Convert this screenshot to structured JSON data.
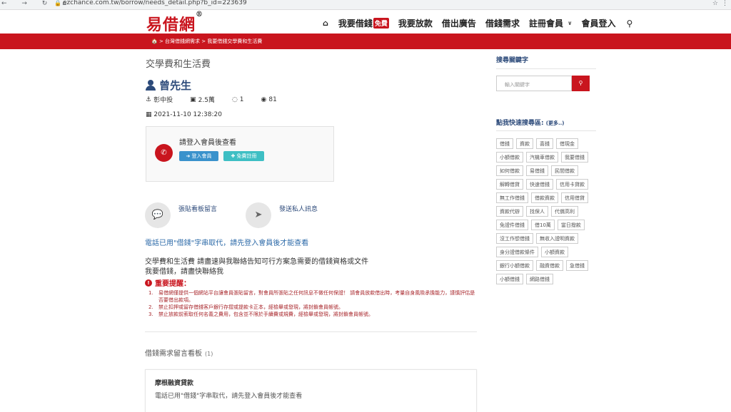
{
  "browser": {
    "nav_icons": "← → ↻ ⌂",
    "url": "ezchance.com.tw/borrow/needs_detail.php?b_id=223639",
    "star": "☆",
    "kebab": "⋮"
  },
  "header": {
    "logo": "易借網",
    "logo_mark": "®",
    "menu": {
      "home_icon": "home-icon",
      "borrow": "我要借錢",
      "borrow_badge": "免費",
      "lend": "我要放款",
      "ad": "借出廣告",
      "needs": "借錢需求",
      "register": "註冊會員",
      "login": "會員登入"
    }
  },
  "breadcrumb": "🏠 > 台灣借錢網需求 > 我要借錢交學費和生活費",
  "post": {
    "title": "交學費和生活費",
    "user": "曾先生",
    "location": "彰中投",
    "amount": "2.5萬",
    "replies": "1",
    "views": "81",
    "datetime": "2021-11-10 12:38:20",
    "login_prompt": "請登入會員後查看",
    "login_button": "登入會員",
    "register_button": "免費註冊",
    "action_board": "張貼看板留言",
    "action_private": "發送私人訊息",
    "phone_note": "電話已用\"借錢\"字串取代，請先登入會員後才能查看",
    "desc_line1": "交學費和生活費 請盡速與我聯絡告知可行方案急需要的借錢資格或文件",
    "desc_line2": "我要借錢，請盡快聯絡我",
    "warning_title": "重要提醒：",
    "warnings": [
      "易借網僅提供一個網站平台讓會員張貼留言，對會員所張貼之任何訊息不做任何保證！ 請會員放款借出時，考量自身風險承擔能力，謹慎評估是否要借出款項。",
      "禁止扣押或留存借錢客戶銀行存摺或提款卡正本，經檢舉或發現，將封鎖會員帳號。",
      "禁止放款前索取任何名義之費用，包含並不限於手續費或規費，經檢舉或發現，將封鎖會員帳號。"
    ],
    "board_title": "借錢需求留言看板",
    "board_count": "(1)",
    "card_title": "摩根融資貸款",
    "card_snippet": "電話已用\"借錢\"字串取代，請先登入會員後才能查看"
  },
  "sidebar": {
    "search_title": "搜尋關鍵字",
    "search_placeholder": "輸入關鍵字",
    "quick_title": "點我快速搜尋區:",
    "quick_more": "(更多..)",
    "tags": [
      "借錢",
      "資款",
      "喜錢",
      "借現金",
      "小額借款",
      "汽機車借款",
      "我要借錢",
      "如何借款",
      "易借錢",
      "民間借款",
      "解轉借貸",
      "快速借錢",
      "信用卡貸款",
      "無工作借錢",
      "借款資款",
      "信用借貸",
      "資款代辦",
      "找保人",
      "代償高利",
      "免證件借錢",
      "借10萬",
      "當日撥款",
      "沒工作想借錢",
      "無收入證明資款",
      "身分證借款條件",
      "小額資款",
      "銀行小額借款",
      "融資借款",
      "急借錢",
      "小額借錢",
      "網路借錢"
    ]
  }
}
